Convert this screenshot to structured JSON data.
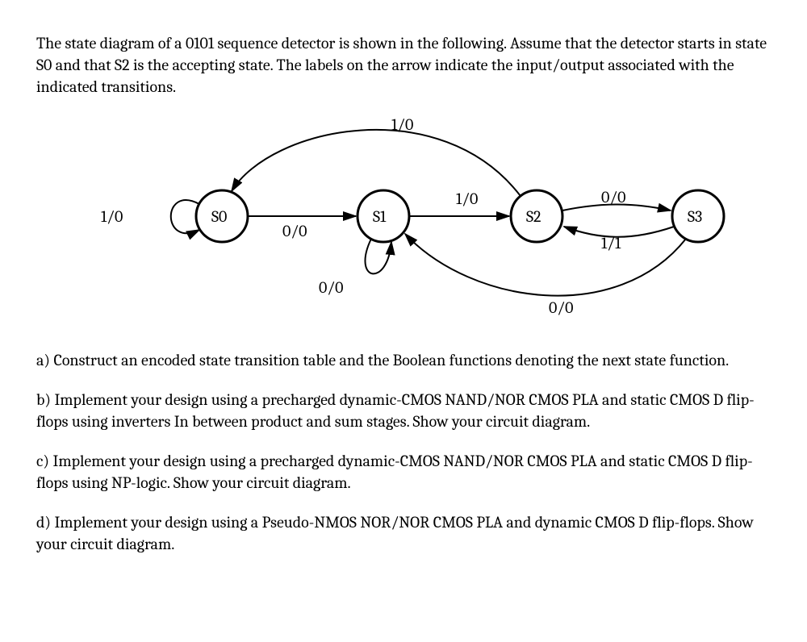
{
  "intro": "The state diagram of a 0101 sequence detector is shown in the following. Assume that the detector starts in state S0 and that S2 is the accepting state. The labels on the arrow indicate the input/output associated with the indicated transitions.",
  "diagram": {
    "states": {
      "s0": "S0",
      "s1": "S1",
      "s2": "S2",
      "s3": "S3"
    },
    "labels": {
      "s0_self": "1/0",
      "s0_s1": "0/0",
      "s1_self": "0/0",
      "s2_s0_top": "1/0",
      "s1_s2": "1/0",
      "s2_s3": "0/0",
      "s3_s2": "1/1",
      "s3_s1_bottom": "0/0"
    }
  },
  "parts": {
    "a": "a) Construct an encoded state transition table and the Boolean functions denoting the next state function.",
    "b": "b)  Implement your design using a precharged dynamic-CMOS NAND/NOR CMOS PLA and static CMOS D flip-flops using inverters In between product and sum stages.  Show your circuit diagram.",
    "c": "c)  Implement your design using a precharged dynamic-CMOS NAND/NOR CMOS PLA and static CMOS D flip-flops using NP-logic.  Show your circuit diagram.",
    "d": "d) Implement your design using a Pseudo-NMOS NOR/NOR CMOS PLA and dynamic CMOS D flip-flops.  Show your circuit diagram."
  }
}
